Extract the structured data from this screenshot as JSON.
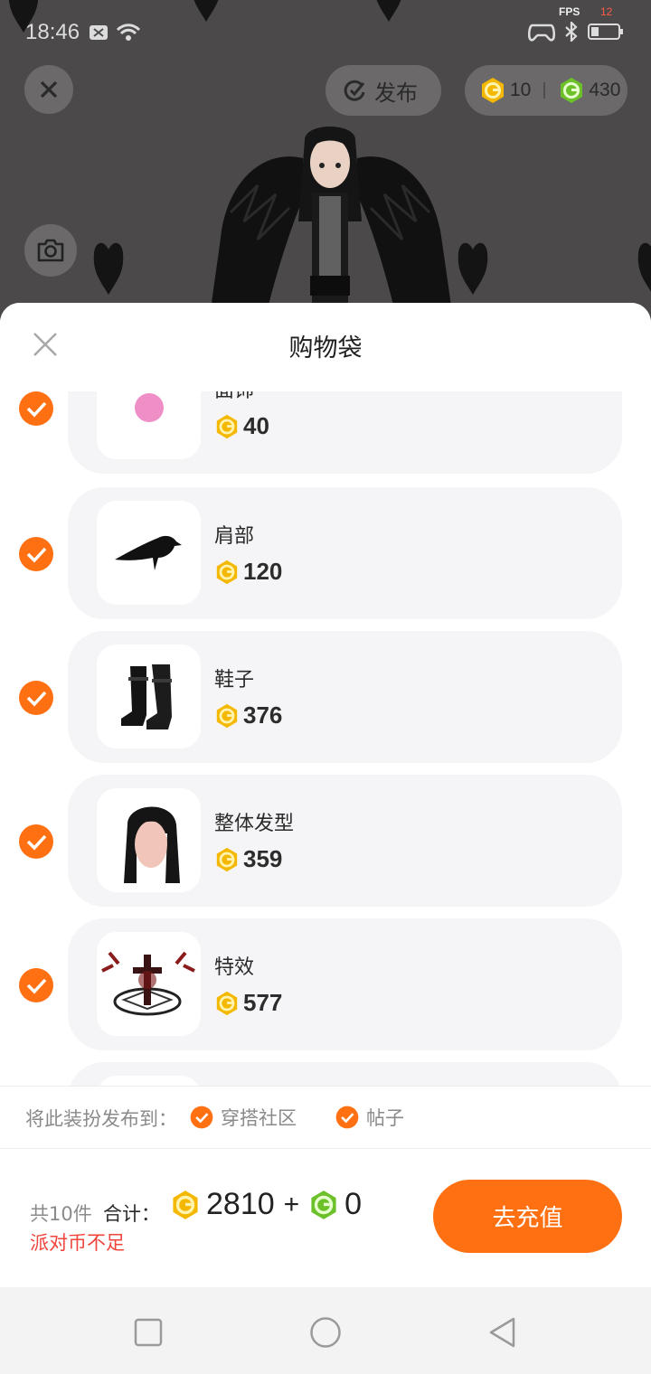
{
  "status_bar": {
    "time": "18:46",
    "fps_label": "FPS",
    "fps_value": "12"
  },
  "top_bar": {
    "publish_label": "发布",
    "party_coins": "10",
    "green_coins": "430"
  },
  "sheet": {
    "title": "购物袋",
    "items": [
      {
        "name": "面饰",
        "price": "40",
        "checked": true
      },
      {
        "name": "肩部",
        "price": "120",
        "checked": true
      },
      {
        "name": "鞋子",
        "price": "376",
        "checked": true
      },
      {
        "name": "整体发型",
        "price": "359",
        "checked": true
      },
      {
        "name": "特效",
        "price": "577",
        "checked": true
      },
      {
        "name": "",
        "price": "",
        "checked": true
      }
    ],
    "publish_to": {
      "label": "将此装扮发布到：",
      "options": [
        {
          "label": "穿搭社区",
          "checked": true
        },
        {
          "label": "帖子",
          "checked": true
        }
      ]
    },
    "footer": {
      "count": "共10件",
      "total_label": "合计：",
      "gold_total": "2810",
      "plus": "+",
      "green_total": "0",
      "warning": "派对币不足",
      "recharge_label": "去充值"
    }
  },
  "colors": {
    "accent": "#ff7012",
    "warning": "#f0443c",
    "gold_coin": "#f5b800",
    "green_coin": "#6cc12a"
  }
}
